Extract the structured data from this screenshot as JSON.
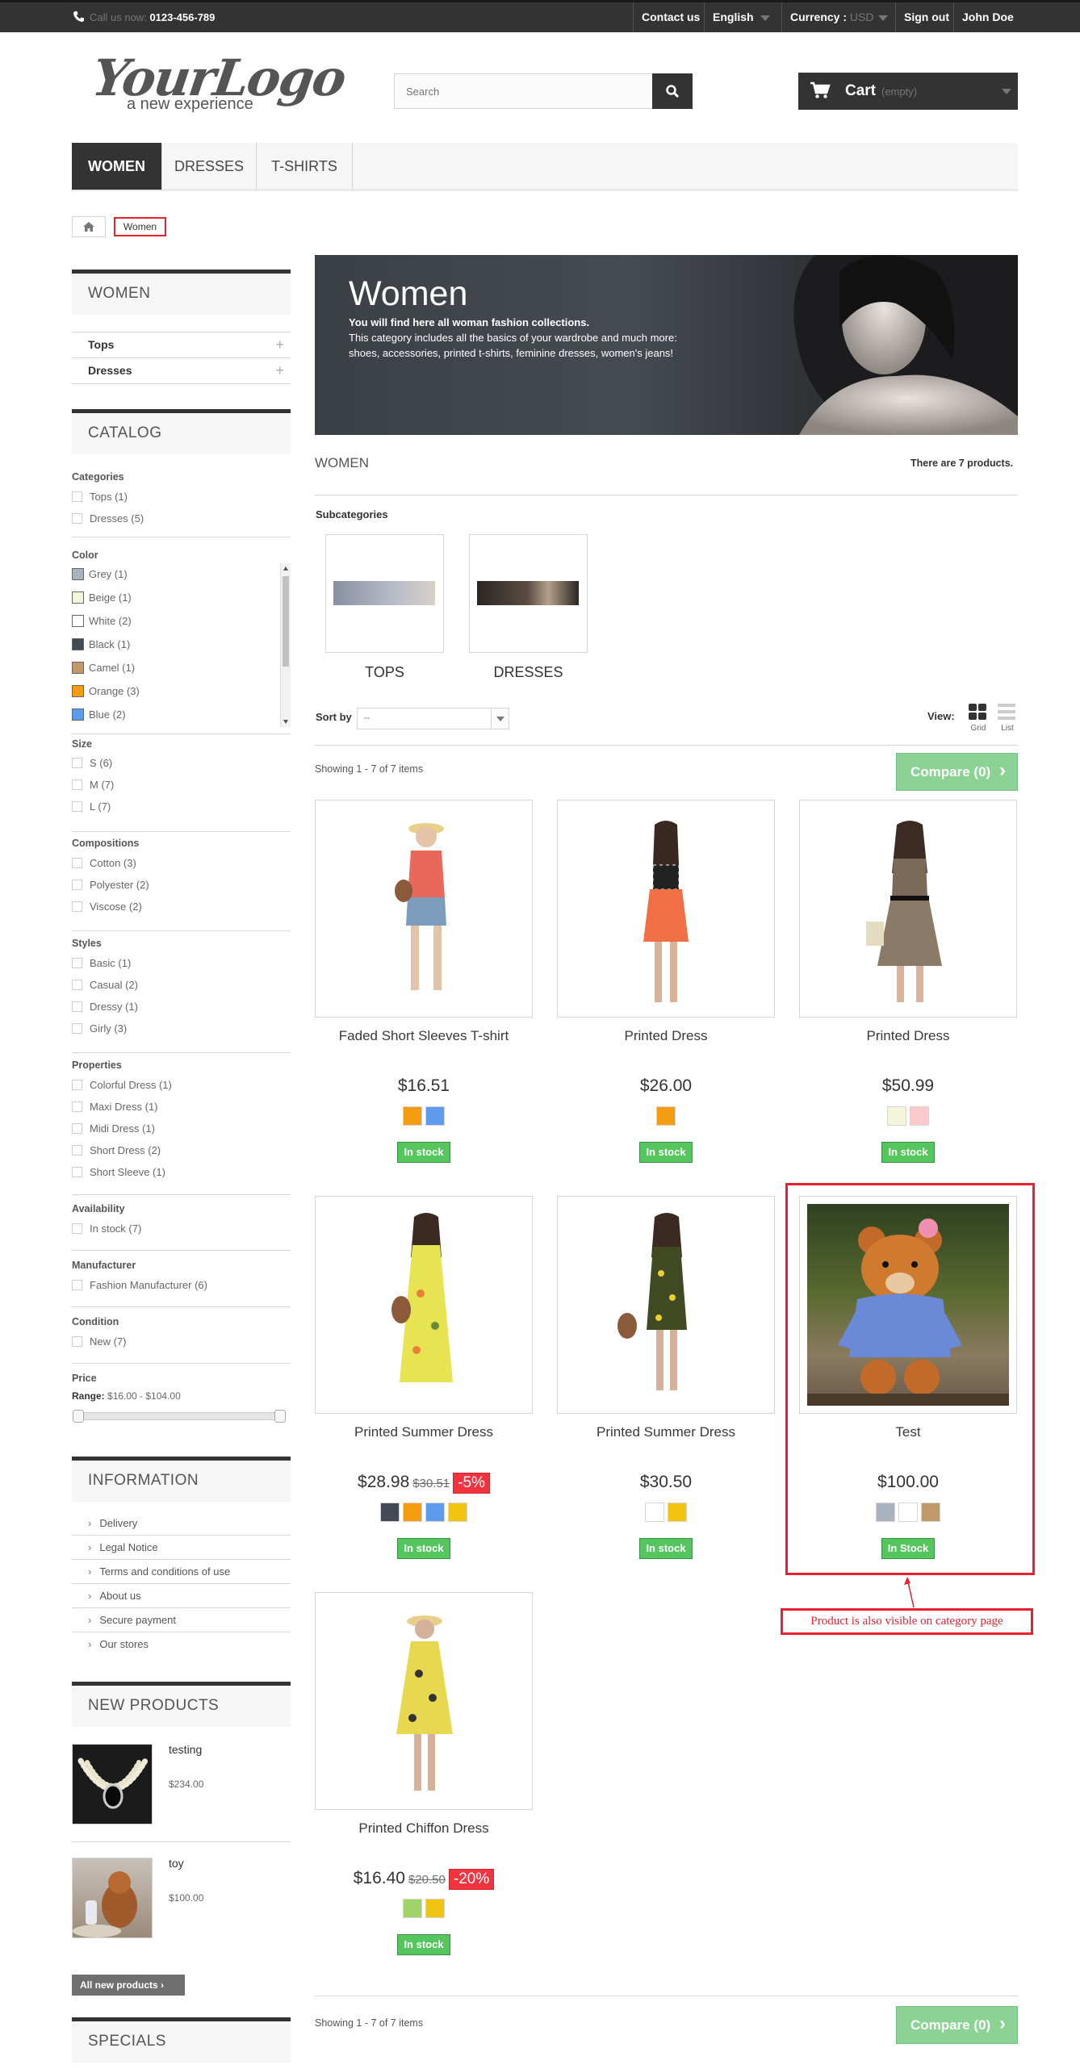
{
  "topbar": {
    "call_label": "Call us now:",
    "phone": "0123-456-789",
    "contact": "Contact us",
    "language": "English",
    "currency_label": "Currency :",
    "currency_value": "USD",
    "signout": "Sign out",
    "user": "John Doe"
  },
  "logo": {
    "text": "YourLogo",
    "tagline": "a new experience"
  },
  "search": {
    "placeholder": "Search"
  },
  "cart": {
    "label": "Cart",
    "status": "(empty)"
  },
  "menu": [
    "WOMEN",
    "DRESSES",
    "T-SHIRTS"
  ],
  "breadcrumb": {
    "current": "Women"
  },
  "sidebar": {
    "women_title": "WOMEN",
    "women_items": [
      "Tops",
      "Dresses"
    ],
    "catalog_title": "CATALOG",
    "filters": {
      "categories": {
        "title": "Categories",
        "items": [
          "Tops (1)",
          "Dresses (5)"
        ]
      },
      "color": {
        "title": "Color",
        "items": [
          {
            "label": "Grey (1)",
            "color": "#AAB2BD"
          },
          {
            "label": "Beige (1)",
            "color": "#f5f5dc"
          },
          {
            "label": "White (2)",
            "color": "#ffffff"
          },
          {
            "label": "Black (1)",
            "color": "#434A54"
          },
          {
            "label": "Camel (1)",
            "color": "#C19A6B"
          },
          {
            "label": "Orange (3)",
            "color": "#F39C11"
          },
          {
            "label": "Blue (2)",
            "color": "#5D9CEC"
          }
        ]
      },
      "size": {
        "title": "Size",
        "items": [
          "S (6)",
          "M (7)",
          "L (7)"
        ]
      },
      "compositions": {
        "title": "Compositions",
        "items": [
          "Cotton (3)",
          "Polyester (2)",
          "Viscose (2)"
        ]
      },
      "styles": {
        "title": "Styles",
        "items": [
          "Basic (1)",
          "Casual (2)",
          "Dressy (1)",
          "Girly (3)"
        ]
      },
      "properties": {
        "title": "Properties",
        "items": [
          "Colorful Dress (1)",
          "Maxi Dress (1)",
          "Midi Dress (1)",
          "Short Dress (2)",
          "Short Sleeve (1)"
        ]
      },
      "availability": {
        "title": "Availability",
        "items": [
          "In stock (7)"
        ]
      },
      "manufacturer": {
        "title": "Manufacturer",
        "items": [
          "Fashion Manufacturer (6)"
        ]
      },
      "condition": {
        "title": "Condition",
        "items": [
          "New (7)"
        ]
      },
      "price": {
        "title": "Price",
        "range_label": "Range:",
        "range": "$16.00 - $104.00"
      }
    },
    "information_title": "INFORMATION",
    "information_items": [
      "Delivery",
      "Legal Notice",
      "Terms and conditions of use",
      "About us",
      "Secure payment",
      "Our stores"
    ],
    "new_products_title": "NEW PRODUCTS",
    "new_products": [
      {
        "name": "testing",
        "price": "$234.00"
      },
      {
        "name": "toy",
        "price": "$100.00"
      }
    ],
    "all_new_button": "All new products",
    "specials_title": "SPECIALS"
  },
  "banner": {
    "title": "Women",
    "subtitle": "You will find here all woman fashion collections.",
    "text1": "This category includes all the basics of your wardrobe and much more:",
    "text2": "shoes, accessories, printed t-shirts, feminine dresses, women's jeans!"
  },
  "category": {
    "title": "WOMEN",
    "count": "There are 7 products."
  },
  "subcategories": {
    "title": "Subcategories",
    "items": [
      "TOPS",
      "DRESSES"
    ]
  },
  "sort": {
    "label": "Sort by",
    "value": "--"
  },
  "view": {
    "label": "View:",
    "grid": "Grid",
    "list": "List"
  },
  "showing": "Showing 1 - 7 of 7 items",
  "compare": "Compare (0)",
  "products": [
    {
      "name": "Faded Short Sleeves T-shirt",
      "price": "$16.51",
      "old": "",
      "discount": "",
      "colors": [
        "#F39C11",
        "#5D9CEC"
      ],
      "stock": "In stock"
    },
    {
      "name": "Printed Dress",
      "price": "$26.00",
      "old": "",
      "discount": "",
      "colors": [
        "#F39C11"
      ],
      "stock": "In stock"
    },
    {
      "name": "Printed Dress",
      "price": "$50.99",
      "old": "",
      "discount": "",
      "colors": [
        "#f5f5dc",
        "#FCCACD"
      ],
      "stock": "In stock"
    },
    {
      "name": "Printed Summer Dress",
      "price": "$28.98",
      "old": "$30.51",
      "discount": "-5%",
      "colors": [
        "#434A54",
        "#F39C11",
        "#5D9CEC",
        "#F1C40F"
      ],
      "stock": "In stock"
    },
    {
      "name": "Printed Summer Dress",
      "price": "$30.50",
      "old": "",
      "discount": "",
      "colors": [
        "#ffffff",
        "#F1C40F"
      ],
      "stock": "In stock"
    },
    {
      "name": "Test",
      "price": "$100.00",
      "old": "",
      "discount": "",
      "colors": [
        "#AAB2BD",
        "#ffffff",
        "#C19A6B"
      ],
      "stock": "In Stock"
    },
    {
      "name": "Printed Chiffon Dress",
      "price": "$16.40",
      "old": "$20.50",
      "discount": "-20%",
      "colors": [
        "#A0D468",
        "#F1C40F"
      ],
      "stock": "In stock"
    }
  ],
  "annotation": "Product is also visible on category page"
}
